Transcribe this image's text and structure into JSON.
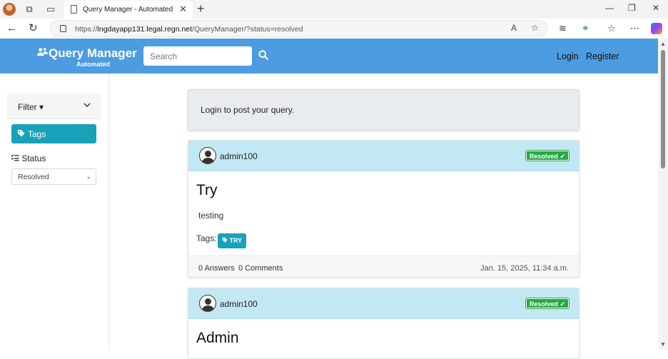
{
  "browser": {
    "tab_title": "Query Manager - Automated",
    "tab_close": "✕",
    "new_tab": "+",
    "url_prefix": "https://",
    "url_host": "lngdayapp131.legal.regn.net",
    "url_path": "/QueryManager/?status=resolved",
    "win_minimize": "—",
    "win_restore": "❐",
    "win_close": "✕"
  },
  "navbar": {
    "brand_name": "Query Manager",
    "brand_sub": "Automated",
    "search_placeholder": "Search",
    "login": "Login",
    "register": "Register"
  },
  "sidebar": {
    "filter_label": "Filter",
    "filter_caret": "▾",
    "tags_label": "Tags",
    "status_label": "Status",
    "status_value": "Resolved"
  },
  "notice": "Login to post your query.",
  "questions": [
    {
      "user": "admin100",
      "status": "Resolved",
      "title": "Try",
      "body": "testing",
      "tags_label": "Tags:",
      "tags": [
        "TRY"
      ],
      "answers": "0 Answers",
      "comments": "0 Comments",
      "date": "Jan. 15, 2025, 11:34 a.m."
    },
    {
      "user": "admin100",
      "status": "Resolved",
      "title": "Admin"
    }
  ],
  "colors": {
    "navbar": "#4d9be1",
    "card_header": "#c2e8f3",
    "tag": "#17a2b8",
    "resolved": "#28a745"
  }
}
